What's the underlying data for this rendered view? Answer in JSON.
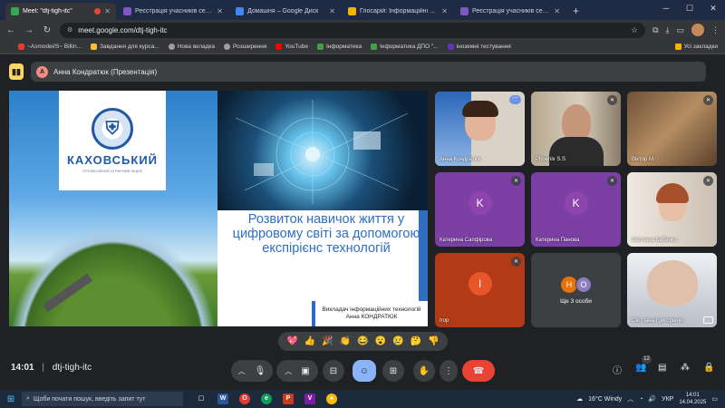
{
  "browser": {
    "tabs": [
      {
        "title": "Meet: \"dtj-tigh-itc\"",
        "active": true,
        "color": "#34a853"
      },
      {
        "title": "Реєстрація учасників семінару",
        "active": false,
        "color": "#7e57c2"
      },
      {
        "title": "Домашня – Google Диск",
        "active": false,
        "color": "#4285f4"
      },
      {
        "title": "Глосарій: Інформаційні мов",
        "active": false,
        "color": "#f4b400"
      },
      {
        "title": "Реєстрація учасників семінару",
        "active": false,
        "color": "#7e57c2"
      }
    ],
    "new_tab": "+",
    "url": "meet.google.com/dtj-tigh-itc",
    "bookmarks": [
      {
        "label": "~Asmodei/S~ Billin...",
        "color": "#e53935"
      },
      {
        "label": "Завдання для курса...",
        "color": "#fbc02d"
      },
      {
        "label": "Нова вкладка",
        "color": "#9e9e9e"
      },
      {
        "label": "Розширення",
        "color": "#9e9e9e"
      },
      {
        "label": "YouTube",
        "color": "#ff0000"
      },
      {
        "label": "Інформатика",
        "color": "#43a047"
      },
      {
        "label": "Інформатика ДПО \"...",
        "color": "#43a047"
      },
      {
        "label": "іноземні тестування",
        "color": "#5e35b1"
      }
    ],
    "bookmarks_right": "Усі закладки"
  },
  "meet": {
    "presenter_bar": {
      "initial": "А",
      "text": "Анна Кондратюк (Презентація)"
    },
    "slide": {
      "logo_name": "КАХОВСЬКИЙ",
      "logo_sub": "ПРОФЕСІЙНИЙ АГРАРНИЙ ЛІЦЕЙ",
      "title": "Розвиток навичок життя у цифровому світі за допомогою експірієнс технологій",
      "author_line1": "Викладач інформаційних технологій",
      "author_line2": "Анна КОНДРАТЮК"
    },
    "participants": [
      {
        "name": "Анна Кондратюк",
        "type": "video"
      },
      {
        "name": "Phoenix S.S",
        "type": "video"
      },
      {
        "name": "Віктор М",
        "type": "video"
      },
      {
        "name": "Катерина Сапфірова",
        "type": "avatar",
        "initial": "K",
        "bg": "#7b3fa6",
        "circle": "#8e44ad"
      },
      {
        "name": "Катерина Панова",
        "type": "avatar",
        "initial": "K",
        "bg": "#7b3fa6",
        "circle": "#8e44ad"
      },
      {
        "name": "Світлана Бабенко",
        "type": "video"
      },
      {
        "name": "Ігор",
        "type": "avatar",
        "initial": "I",
        "bg": "#b23a16",
        "circle": "#e8552a"
      },
      {
        "name": "Ще 3 особи",
        "type": "group",
        "initials": [
          "Н",
          "О"
        ]
      },
      {
        "name": "Світлана Григоренко",
        "type": "video"
      }
    ],
    "reactions": [
      "💖",
      "👍",
      "🎉",
      "👏",
      "😂",
      "😮",
      "😢",
      "🤔",
      "👎"
    ],
    "time": "14:01",
    "meeting_code": "dtj-tigh-itc",
    "participants_count": "12"
  },
  "taskbar": {
    "search_placeholder": "Щоби почати пошук, введіть запит тут",
    "weather": "16°C Windy",
    "lang": "УКР",
    "time": "14:01",
    "date": "14.04.2025"
  }
}
